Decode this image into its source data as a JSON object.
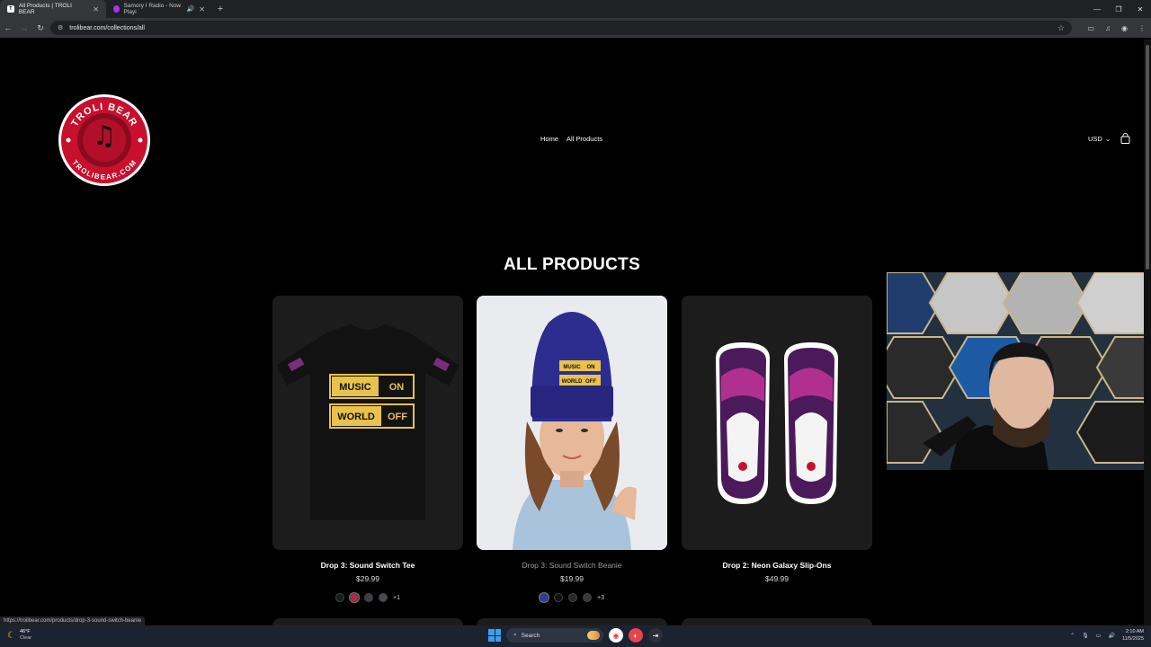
{
  "browser": {
    "tabs": [
      {
        "favicon": "T",
        "title": "All Products | TROLI BEAR",
        "active": true
      },
      {
        "favicon": "",
        "title": "Samory I Radio - Now Playi",
        "active": false,
        "audio": true
      }
    ],
    "address": "trolibear.com/collections/all",
    "status_url": "https://trolibear.com/products/drop-3-sound-switch-beanie"
  },
  "site": {
    "logo_top_text": "TROLI BEAR",
    "logo_bottom_text": "TROLIBEAR.COM",
    "nav": [
      {
        "label": "Home"
      },
      {
        "label": "All Products"
      }
    ],
    "currency": "USD",
    "heading": "ALL PRODUCTS"
  },
  "products": [
    {
      "name": "Drop 3: Sound Switch Tee",
      "price": "$29.99",
      "swatches": [
        "#1a1a1a",
        "#c1204a",
        "#3a3f4a",
        "#4a4a4a"
      ],
      "more": "+1",
      "print_line1": [
        "MUSIC",
        "ON"
      ],
      "print_line2": [
        "WORLD",
        "OFF"
      ]
    },
    {
      "name": "Drop 3: Sound Switch Beanie",
      "price": "$19.99",
      "swatches": [
        "#2b3aa8",
        "#111111",
        "#2a2a2a",
        "#3a3a3a"
      ],
      "more": "+3",
      "print_line1": [
        "MUSIC",
        "ON"
      ],
      "print_line2": [
        "WORLD",
        "OFF"
      ]
    },
    {
      "name": "Drop 2: Neon Galaxy Slip-Ons",
      "price": "$49.99",
      "swatches": [],
      "more": ""
    }
  ],
  "taskbar": {
    "weather_temp": "46°F",
    "weather_desc": "Clear",
    "search_placeholder": "Search",
    "time": "2:10 AM",
    "date": "11/5/2025"
  },
  "colors": {
    "brand_red": "#c8102e",
    "gold": "#e8c24a"
  }
}
